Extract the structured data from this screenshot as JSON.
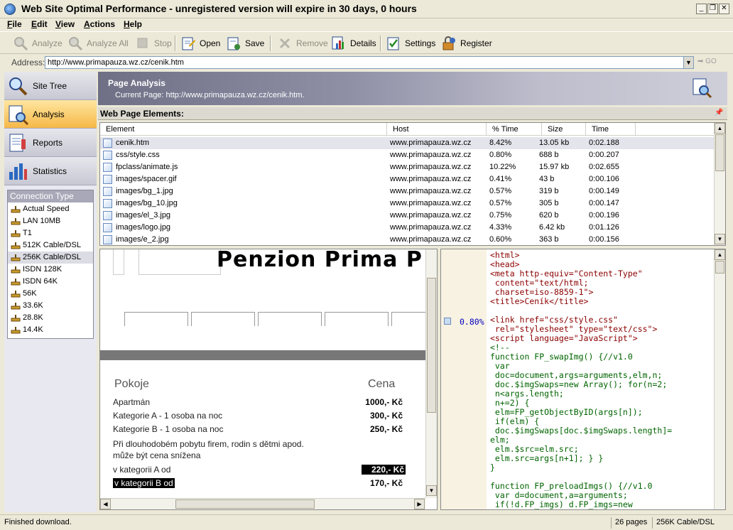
{
  "window": {
    "title": "Web Site Optimal Performance - unregistered version will expire in 30 days, 0 hours"
  },
  "menu": [
    {
      "label": "File",
      "u": "F",
      "rest": "ile"
    },
    {
      "label": "Edit",
      "u": "E",
      "rest": "dit"
    },
    {
      "label": "View",
      "u": "V",
      "rest": "iew"
    },
    {
      "label": "Actions",
      "u": "A",
      "rest": "ctions"
    },
    {
      "label": "Help",
      "u": "H",
      "rest": "elp"
    }
  ],
  "toolbar": {
    "analyze": "Analyze",
    "analyze_all": "Analyze All",
    "stop": "Stop",
    "open": "Open",
    "save": "Save",
    "remove": "Remove",
    "details": "Details",
    "settings": "Settings",
    "register": "Register"
  },
  "address": {
    "label": "Address:",
    "value": "http://www.primapauza.wz.cz/cenik.htm",
    "go": "GO"
  },
  "sidebar": {
    "nav": [
      {
        "label": "Site Tree",
        "icon": "magnifier-tree-icon",
        "active": false
      },
      {
        "label": "Analysis",
        "icon": "analysis-icon",
        "active": true
      },
      {
        "label": "Reports",
        "icon": "reports-icon",
        "active": false
      },
      {
        "label": "Statistics",
        "icon": "statistics-icon",
        "active": false
      }
    ],
    "connection_header": "Connection Type",
    "connections": [
      "Actual Speed",
      "LAN 10MB",
      "T1",
      "512K Cable/DSL",
      "256K Cable/DSL",
      "ISDN 128K",
      "ISDN 64K",
      "56K",
      "33.6K",
      "28.8K",
      "14.4K"
    ],
    "selected_connection": "256K Cable/DSL"
  },
  "page_analysis": {
    "title": "Page Analysis",
    "current_page": "Current Page: http://www.primapauza.wz.cz/cenik.htm."
  },
  "elements": {
    "label": "Web Page Elements:",
    "columns": [
      "Element",
      "Host",
      "% Time",
      "Size",
      "Time"
    ],
    "rows": [
      {
        "element": "cenik.htm",
        "host": "www.primapauza.wz.cz",
        "pct": "8.42%",
        "size": "13.05 kb",
        "time": "0:02.188"
      },
      {
        "element": "css/style.css",
        "host": "www.primapauza.wz.cz",
        "pct": "0.80%",
        "size": "688 b",
        "time": "0:00.207"
      },
      {
        "element": "fpclass/animate.js",
        "host": "www.primapauza.wz.cz",
        "pct": "10.22%",
        "size": "15.97 kb",
        "time": "0:02.655"
      },
      {
        "element": "images/spacer.gif",
        "host": "www.primapauza.wz.cz",
        "pct": "0.41%",
        "size": "43 b",
        "time": "0:00.106"
      },
      {
        "element": "images/bg_1.jpg",
        "host": "www.primapauza.wz.cz",
        "pct": "0.57%",
        "size": "319 b",
        "time": "0:00.149"
      },
      {
        "element": "images/bg_10.jpg",
        "host": "www.primapauza.wz.cz",
        "pct": "0.57%",
        "size": "305 b",
        "time": "0:00.147"
      },
      {
        "element": "images/el_3.jpg",
        "host": "www.primapauza.wz.cz",
        "pct": "0.75%",
        "size": "620 b",
        "time": "0:00.196"
      },
      {
        "element": "images/logo.jpg",
        "host": "www.primapauza.wz.cz",
        "pct": "4.33%",
        "size": "6.42 kb",
        "time": "0:01.126"
      },
      {
        "element": "images/e_2.jpg",
        "host": "www.primapauza.wz.cz",
        "pct": "0.60%",
        "size": "363 b",
        "time": "0:00.156"
      }
    ]
  },
  "preview": {
    "title": "Penzion Prima P",
    "pokoje": "Pokoje",
    "cena": "Cena",
    "lines": [
      {
        "text": "Apartmán",
        "price": "1000,- Kč"
      },
      {
        "text": "Kategorie A - 1 osoba na noc",
        "price": "300,- Kč"
      },
      {
        "text": "Kategorie B - 1 osoba na noc",
        "price": "250,- Kč"
      }
    ],
    "note1": "Při dlouhodobém pobytu firem, rodin s dětmi apod.",
    "note2": "může být cena snížena",
    "cat_a": "v kategorii A  od",
    "cat_a_price": "220,- Kč",
    "cat_b": "v kategorii B  od",
    "cat_b_price": "170,- Kč"
  },
  "source": {
    "gutter_pct": "0.80%",
    "lines": [
      "<html>",
      "<head>",
      "<meta http-equiv=\"Content-Type\"",
      " content=\"text/html;",
      " charset=iso-8859-1\">",
      "<title>Ceník</title>",
      "",
      "<link href=\"css/style.css\"",
      " rel=\"stylesheet\" type=\"text/css\">",
      "<script language=\"JavaScript\">",
      "<!--",
      "function FP_swapImg() {//v1.0",
      " var",
      " doc=document,args=arguments,elm,n;",
      " doc.$imgSwaps=new Array(); for(n=2;",
      " n<args.length;",
      " n+=2) {",
      " elm=FP_getObjectByID(args[n]);",
      " if(elm) {",
      " doc.$imgSwaps[doc.$imgSwaps.length]=",
      "elm;",
      " elm.$src=elm.src;",
      " elm.src=args[n+1]; } }",
      "}",
      "",
      "function FP_preloadImgs() {//v1.0",
      " var d=document,a=arguments;",
      " if(!d.FP_imgs) d.FP_imgs=new"
    ]
  },
  "status": {
    "message": "Finished download.",
    "pages": "26 pages",
    "connection": "256K Cable/DSL"
  },
  "colors": {
    "accent": "#f6b848",
    "header_gradient": "#6f6f86"
  }
}
